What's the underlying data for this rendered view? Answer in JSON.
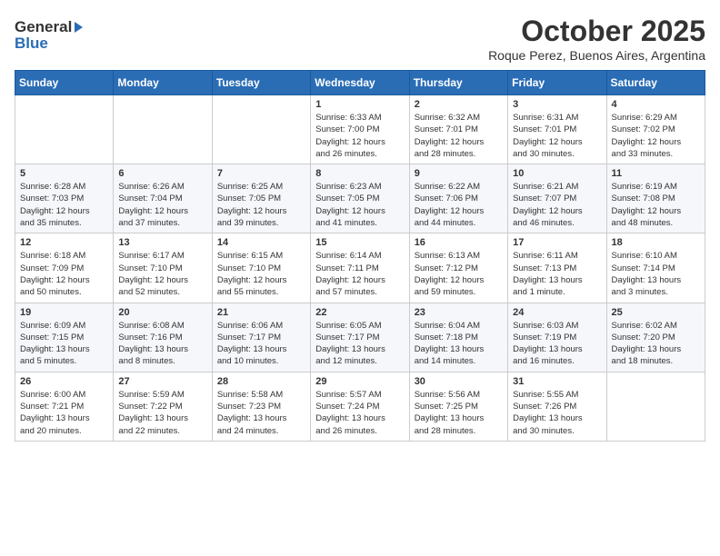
{
  "header": {
    "logo_general": "General",
    "logo_blue": "Blue",
    "month_title": "October 2025",
    "subtitle": "Roque Perez, Buenos Aires, Argentina"
  },
  "days_of_week": [
    "Sunday",
    "Monday",
    "Tuesday",
    "Wednesday",
    "Thursday",
    "Friday",
    "Saturday"
  ],
  "weeks": [
    [
      {
        "day": "",
        "info": ""
      },
      {
        "day": "",
        "info": ""
      },
      {
        "day": "",
        "info": ""
      },
      {
        "day": "1",
        "info": "Sunrise: 6:33 AM\nSunset: 7:00 PM\nDaylight: 12 hours\nand 26 minutes."
      },
      {
        "day": "2",
        "info": "Sunrise: 6:32 AM\nSunset: 7:01 PM\nDaylight: 12 hours\nand 28 minutes."
      },
      {
        "day": "3",
        "info": "Sunrise: 6:31 AM\nSunset: 7:01 PM\nDaylight: 12 hours\nand 30 minutes."
      },
      {
        "day": "4",
        "info": "Sunrise: 6:29 AM\nSunset: 7:02 PM\nDaylight: 12 hours\nand 33 minutes."
      }
    ],
    [
      {
        "day": "5",
        "info": "Sunrise: 6:28 AM\nSunset: 7:03 PM\nDaylight: 12 hours\nand 35 minutes."
      },
      {
        "day": "6",
        "info": "Sunrise: 6:26 AM\nSunset: 7:04 PM\nDaylight: 12 hours\nand 37 minutes."
      },
      {
        "day": "7",
        "info": "Sunrise: 6:25 AM\nSunset: 7:05 PM\nDaylight: 12 hours\nand 39 minutes."
      },
      {
        "day": "8",
        "info": "Sunrise: 6:23 AM\nSunset: 7:05 PM\nDaylight: 12 hours\nand 41 minutes."
      },
      {
        "day": "9",
        "info": "Sunrise: 6:22 AM\nSunset: 7:06 PM\nDaylight: 12 hours\nand 44 minutes."
      },
      {
        "day": "10",
        "info": "Sunrise: 6:21 AM\nSunset: 7:07 PM\nDaylight: 12 hours\nand 46 minutes."
      },
      {
        "day": "11",
        "info": "Sunrise: 6:19 AM\nSunset: 7:08 PM\nDaylight: 12 hours\nand 48 minutes."
      }
    ],
    [
      {
        "day": "12",
        "info": "Sunrise: 6:18 AM\nSunset: 7:09 PM\nDaylight: 12 hours\nand 50 minutes."
      },
      {
        "day": "13",
        "info": "Sunrise: 6:17 AM\nSunset: 7:10 PM\nDaylight: 12 hours\nand 52 minutes."
      },
      {
        "day": "14",
        "info": "Sunrise: 6:15 AM\nSunset: 7:10 PM\nDaylight: 12 hours\nand 55 minutes."
      },
      {
        "day": "15",
        "info": "Sunrise: 6:14 AM\nSunset: 7:11 PM\nDaylight: 12 hours\nand 57 minutes."
      },
      {
        "day": "16",
        "info": "Sunrise: 6:13 AM\nSunset: 7:12 PM\nDaylight: 12 hours\nand 59 minutes."
      },
      {
        "day": "17",
        "info": "Sunrise: 6:11 AM\nSunset: 7:13 PM\nDaylight: 13 hours\nand 1 minute."
      },
      {
        "day": "18",
        "info": "Sunrise: 6:10 AM\nSunset: 7:14 PM\nDaylight: 13 hours\nand 3 minutes."
      }
    ],
    [
      {
        "day": "19",
        "info": "Sunrise: 6:09 AM\nSunset: 7:15 PM\nDaylight: 13 hours\nand 5 minutes."
      },
      {
        "day": "20",
        "info": "Sunrise: 6:08 AM\nSunset: 7:16 PM\nDaylight: 13 hours\nand 8 minutes."
      },
      {
        "day": "21",
        "info": "Sunrise: 6:06 AM\nSunset: 7:17 PM\nDaylight: 13 hours\nand 10 minutes."
      },
      {
        "day": "22",
        "info": "Sunrise: 6:05 AM\nSunset: 7:17 PM\nDaylight: 13 hours\nand 12 minutes."
      },
      {
        "day": "23",
        "info": "Sunrise: 6:04 AM\nSunset: 7:18 PM\nDaylight: 13 hours\nand 14 minutes."
      },
      {
        "day": "24",
        "info": "Sunrise: 6:03 AM\nSunset: 7:19 PM\nDaylight: 13 hours\nand 16 minutes."
      },
      {
        "day": "25",
        "info": "Sunrise: 6:02 AM\nSunset: 7:20 PM\nDaylight: 13 hours\nand 18 minutes."
      }
    ],
    [
      {
        "day": "26",
        "info": "Sunrise: 6:00 AM\nSunset: 7:21 PM\nDaylight: 13 hours\nand 20 minutes."
      },
      {
        "day": "27",
        "info": "Sunrise: 5:59 AM\nSunset: 7:22 PM\nDaylight: 13 hours\nand 22 minutes."
      },
      {
        "day": "28",
        "info": "Sunrise: 5:58 AM\nSunset: 7:23 PM\nDaylight: 13 hours\nand 24 minutes."
      },
      {
        "day": "29",
        "info": "Sunrise: 5:57 AM\nSunset: 7:24 PM\nDaylight: 13 hours\nand 26 minutes."
      },
      {
        "day": "30",
        "info": "Sunrise: 5:56 AM\nSunset: 7:25 PM\nDaylight: 13 hours\nand 28 minutes."
      },
      {
        "day": "31",
        "info": "Sunrise: 5:55 AM\nSunset: 7:26 PM\nDaylight: 13 hours\nand 30 minutes."
      },
      {
        "day": "",
        "info": ""
      }
    ]
  ]
}
